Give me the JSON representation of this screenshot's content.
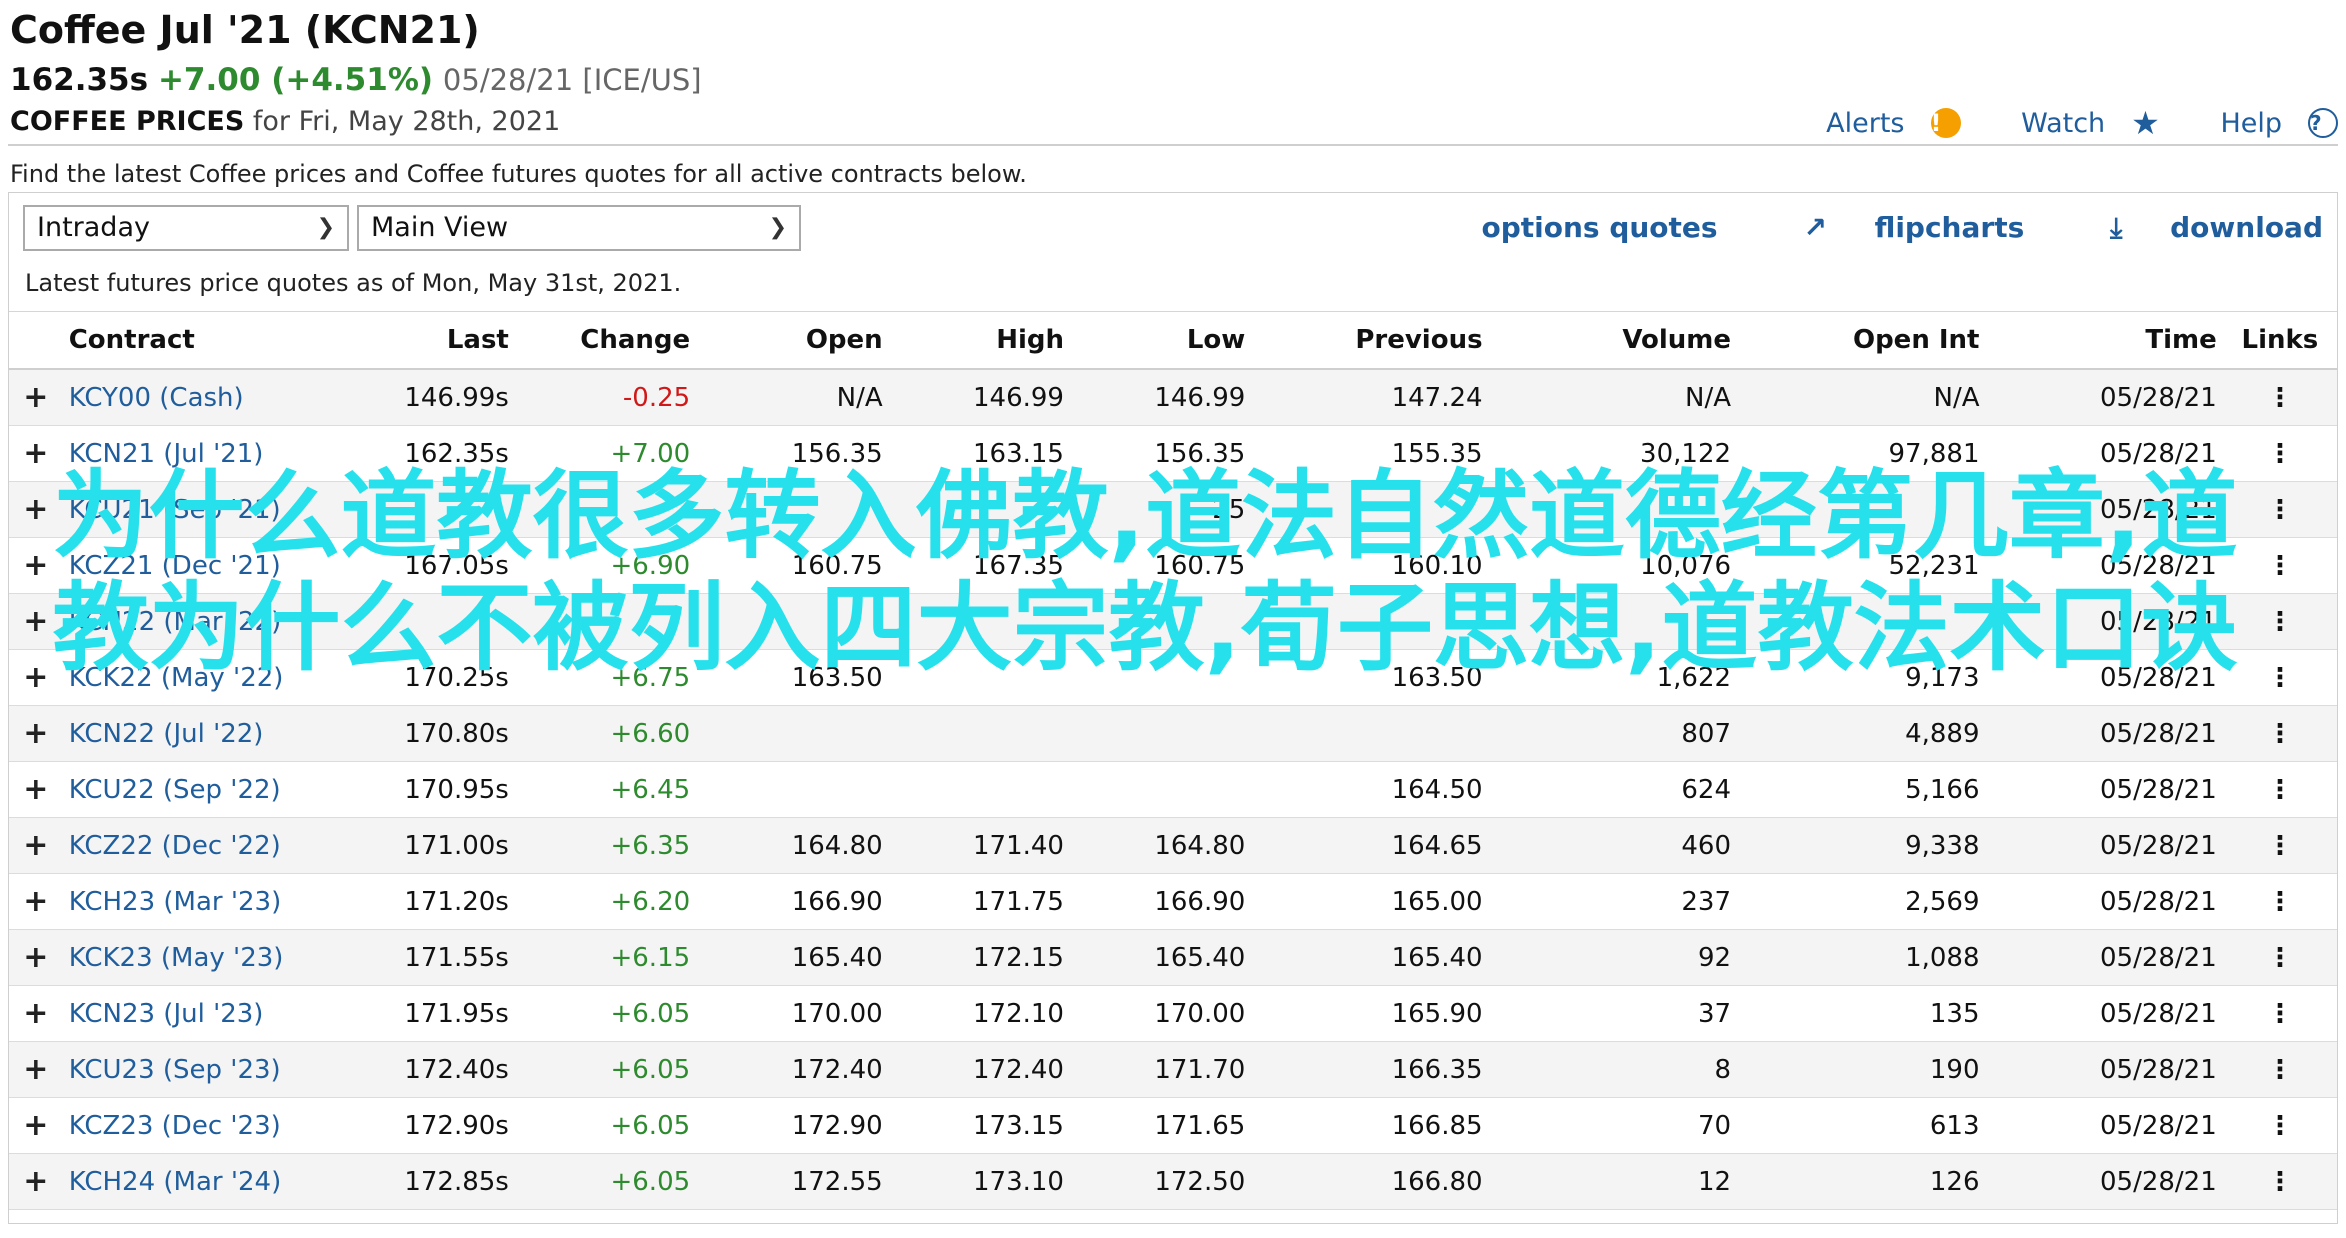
{
  "header": {
    "title": "Coffee Jul '21 (KCN21)",
    "price": "162.35s",
    "change": "+7.00 (+4.51%)",
    "meta": "05/28/21 [ICE/US]",
    "prices_label": "COFFEE PRICES",
    "prices_date": "for Fri, May 28th, 2021"
  },
  "top_links": {
    "alerts": "Alerts",
    "watch": "Watch",
    "help": "Help"
  },
  "intro": "Find the latest Coffee prices and Coffee futures quotes for all active contracts below.",
  "controls": {
    "period_select": "Intraday",
    "view_select": "Main View",
    "options_quotes": "options quotes",
    "flipcharts": "flipcharts",
    "download": "download"
  },
  "as_of": "Latest futures price quotes as of Mon, May 31st, 2021.",
  "table": {
    "columns": [
      "Contract",
      "Last",
      "Change",
      "Open",
      "High",
      "Low",
      "Previous",
      "Volume",
      "Open Int",
      "Time",
      "Links"
    ],
    "rows": [
      {
        "contract": "KCY00 (Cash)",
        "last": "146.99s",
        "change": "-0.25",
        "dir": "dn",
        "open": "N/A",
        "high": "146.99",
        "low": "146.99",
        "previous": "147.24",
        "volume": "N/A",
        "open_int": "N/A",
        "time": "05/28/21"
      },
      {
        "contract": "KCN21 (Jul '21)",
        "last": "162.35s",
        "change": "+7.00",
        "dir": "up",
        "open": "156.35",
        "high": "163.15",
        "low": "156.35",
        "previous": "155.35",
        "volume": "30,122",
        "open_int": "97,881",
        "time": "05/28/21"
      },
      {
        "contract": "KCU21 (Sep '21)",
        "last": "",
        "change": "",
        "dir": "up",
        "open": "",
        "high": "",
        "low": "25",
        "previous": "",
        "volume": "",
        "open_int": "",
        "time": "05/28/21"
      },
      {
        "contract": "KCZ21 (Dec '21)",
        "last": "167.05s",
        "change": "+6.90",
        "dir": "up",
        "open": "160.75",
        "high": "167.35",
        "low": "160.75",
        "previous": "160.10",
        "volume": "10,076",
        "open_int": "52,231",
        "time": "05/28/21"
      },
      {
        "contract": "KCH22 (Mar '22)",
        "last": "",
        "change": "",
        "dir": "up",
        "open": "",
        "high": "",
        "low": "",
        "previous": "",
        "volume": "",
        "open_int": "",
        "time": "05/28/21"
      },
      {
        "contract": "KCK22 (May '22)",
        "last": "170.25s",
        "change": "+6.75",
        "dir": "up",
        "open": "163.50",
        "high": "",
        "low": "",
        "previous": "163.50",
        "volume": "1,622",
        "open_int": "9,173",
        "time": "05/28/21"
      },
      {
        "contract": "KCN22 (Jul '22)",
        "last": "170.80s",
        "change": "+6.60",
        "dir": "up",
        "open": "",
        "high": "",
        "low": "",
        "previous": "",
        "volume": "807",
        "open_int": "4,889",
        "time": "05/28/21"
      },
      {
        "contract": "KCU22 (Sep '22)",
        "last": "170.95s",
        "change": "+6.45",
        "dir": "up",
        "open": "",
        "high": "",
        "low": "",
        "previous": "164.50",
        "volume": "624",
        "open_int": "5,166",
        "time": "05/28/21"
      },
      {
        "contract": "KCZ22 (Dec '22)",
        "last": "171.00s",
        "change": "+6.35",
        "dir": "up",
        "open": "164.80",
        "high": "171.40",
        "low": "164.80",
        "previous": "164.65",
        "volume": "460",
        "open_int": "9,338",
        "time": "05/28/21"
      },
      {
        "contract": "KCH23 (Mar '23)",
        "last": "171.20s",
        "change": "+6.20",
        "dir": "up",
        "open": "166.90",
        "high": "171.75",
        "low": "166.90",
        "previous": "165.00",
        "volume": "237",
        "open_int": "2,569",
        "time": "05/28/21"
      },
      {
        "contract": "KCK23 (May '23)",
        "last": "171.55s",
        "change": "+6.15",
        "dir": "up",
        "open": "165.40",
        "high": "172.15",
        "low": "165.40",
        "previous": "165.40",
        "volume": "92",
        "open_int": "1,088",
        "time": "05/28/21"
      },
      {
        "contract": "KCN23 (Jul '23)",
        "last": "171.95s",
        "change": "+6.05",
        "dir": "up",
        "open": "170.00",
        "high": "172.10",
        "low": "170.00",
        "previous": "165.90",
        "volume": "37",
        "open_int": "135",
        "time": "05/28/21"
      },
      {
        "contract": "KCU23 (Sep '23)",
        "last": "172.40s",
        "change": "+6.05",
        "dir": "up",
        "open": "172.40",
        "high": "172.40",
        "low": "171.70",
        "previous": "166.35",
        "volume": "8",
        "open_int": "190",
        "time": "05/28/21"
      },
      {
        "contract": "KCZ23 (Dec '23)",
        "last": "172.90s",
        "change": "+6.05",
        "dir": "up",
        "open": "172.90",
        "high": "173.15",
        "low": "171.65",
        "previous": "166.85",
        "volume": "70",
        "open_int": "613",
        "time": "05/28/21"
      },
      {
        "contract": "KCH24 (Mar '24)",
        "last": "172.85s",
        "change": "+6.05",
        "dir": "up",
        "open": "172.55",
        "high": "173.10",
        "low": "172.50",
        "previous": "166.80",
        "volume": "12",
        "open_int": "126",
        "time": "05/28/21"
      }
    ]
  },
  "overlay_text": "为什么道教很多转入佛教,道法自然道德经第几章,道教为什么不被列入四大宗教,荀子思想,道教法术口诀"
}
